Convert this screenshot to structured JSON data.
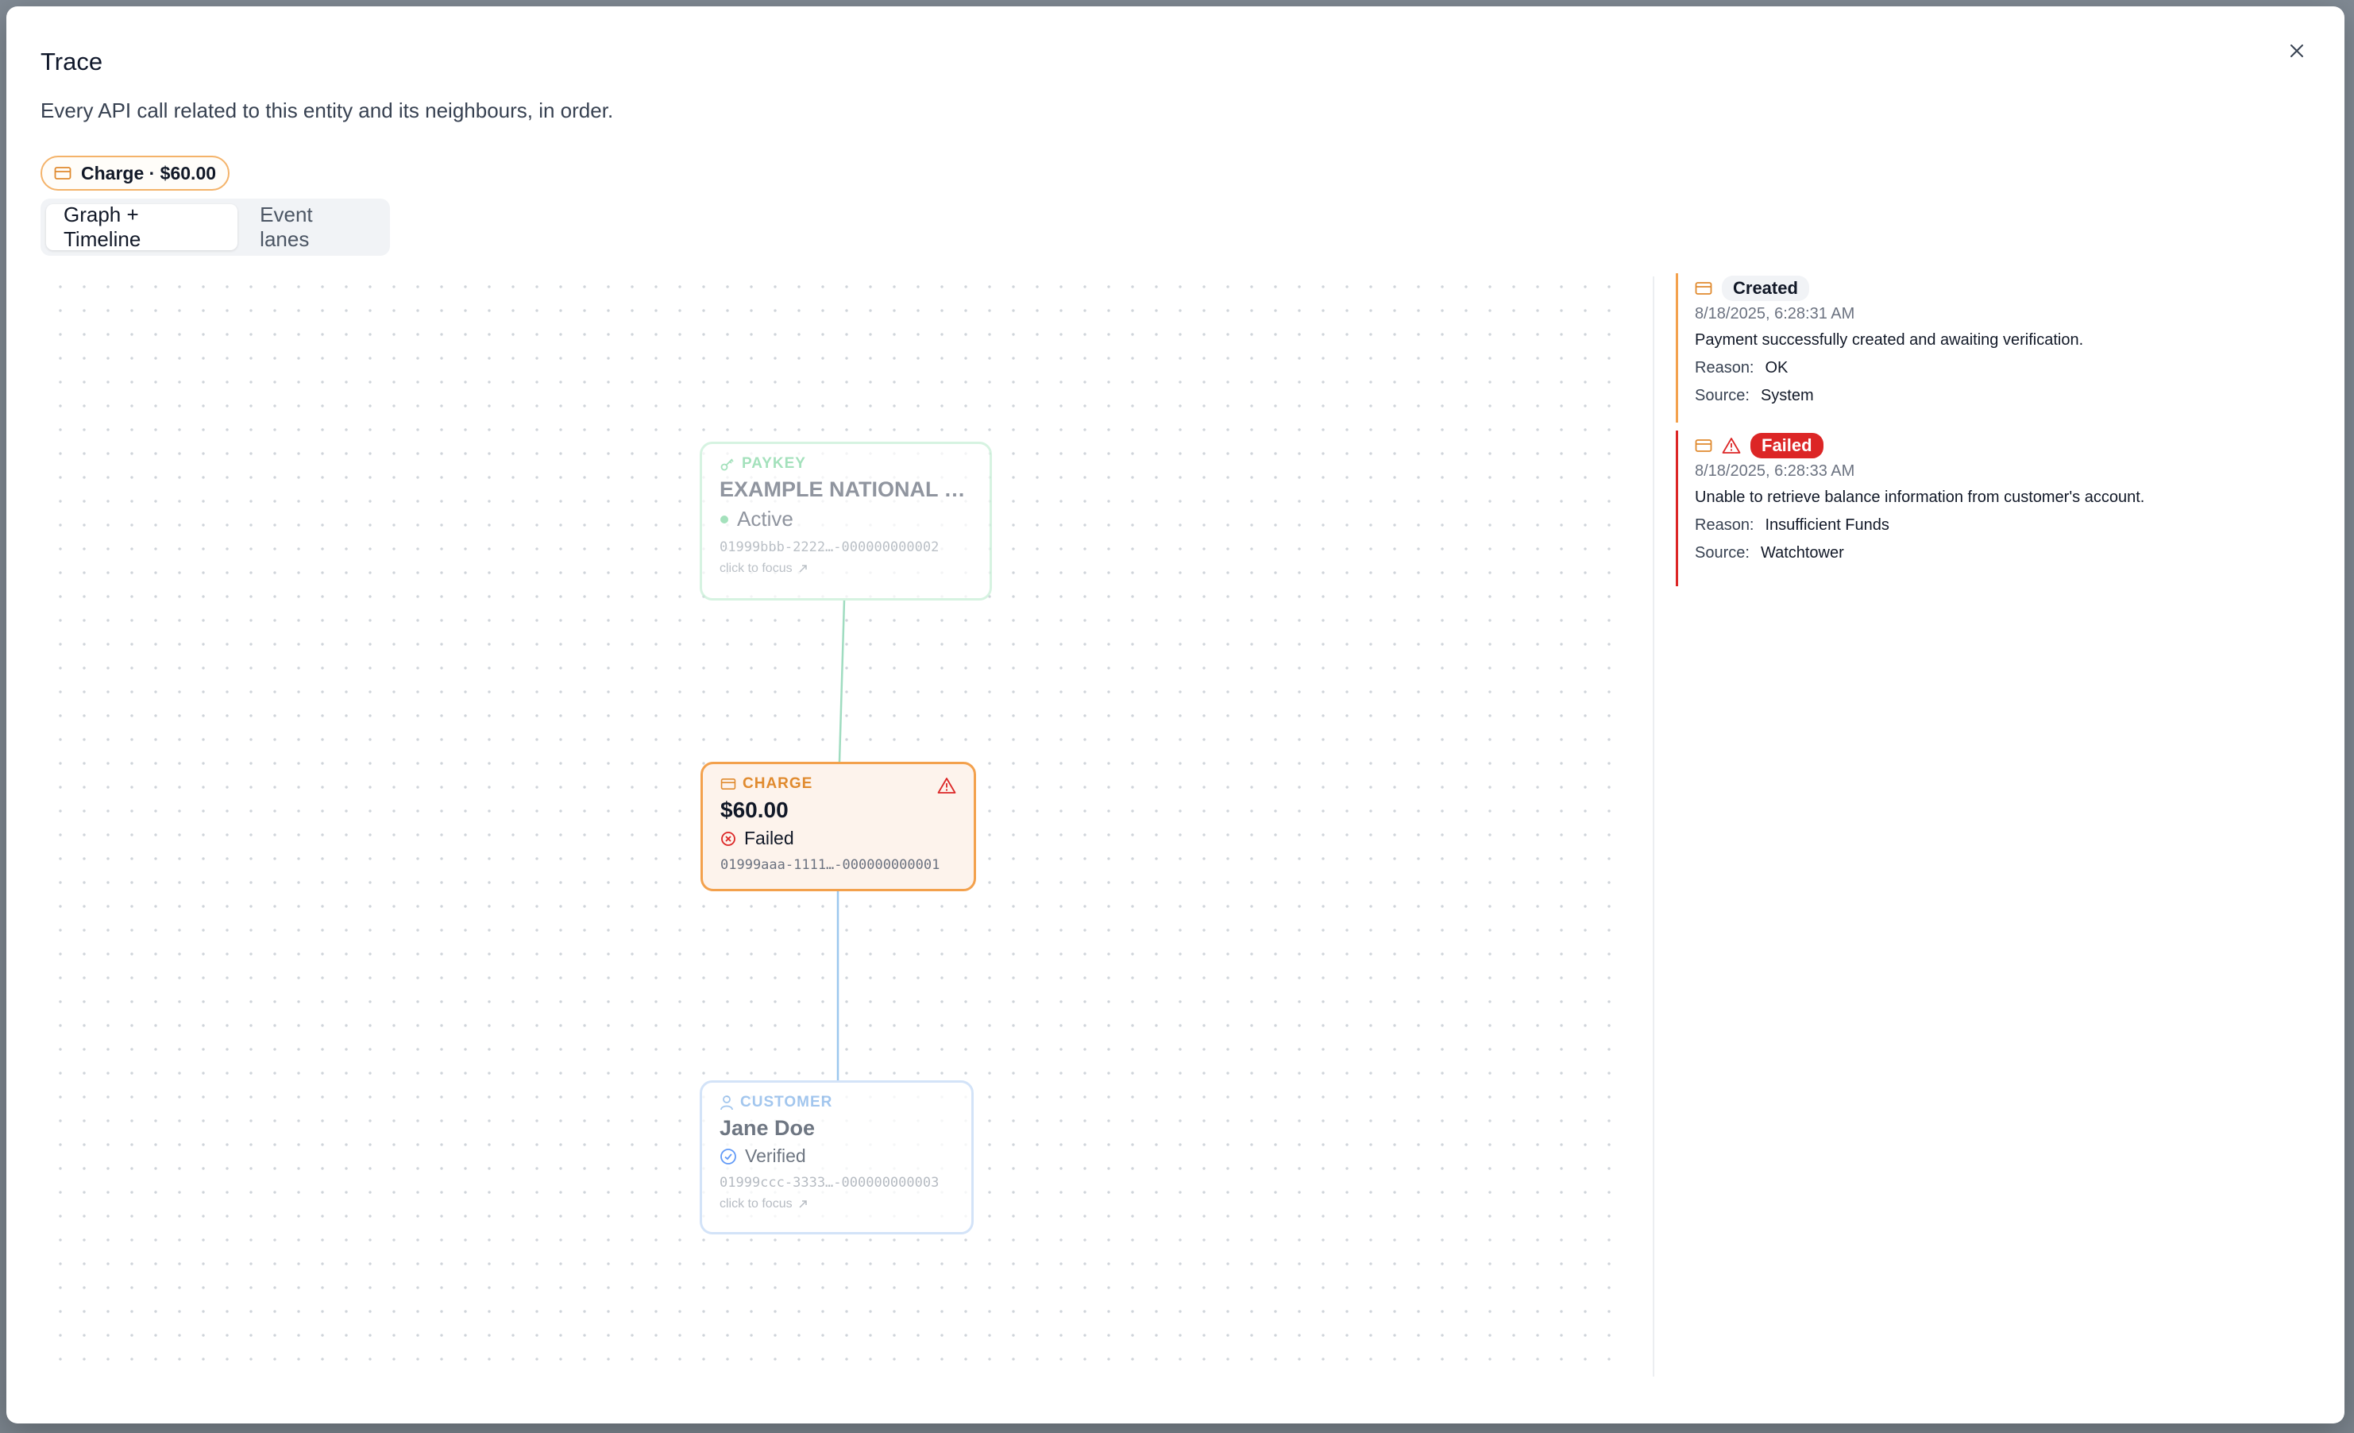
{
  "dialog": {
    "title": "Trace",
    "subtitle": "Every API call related to this entity and its neighbours, in order.",
    "entity_chip": "Charge · $60.00",
    "tabs": [
      {
        "label": "Graph + Timeline",
        "active": true
      },
      {
        "label": "Event lanes",
        "active": false
      }
    ]
  },
  "graph": {
    "nodes": {
      "paykey": {
        "kind": "PAYKEY",
        "name": "EXAMPLE NATIONAL B...",
        "status": "Active",
        "id": "01999bbb-2222…-000000000002",
        "hint": "click to focus"
      },
      "charge": {
        "kind": "CHARGE",
        "name": "$60.00",
        "status": "Failed",
        "id": "01999aaa-1111…-000000000001"
      },
      "customer": {
        "kind": "CUSTOMER",
        "name": "Jane Doe",
        "status": "Verified",
        "id": "01999ccc-3333…-000000000003",
        "hint": "click to focus"
      }
    }
  },
  "timeline": {
    "events": [
      {
        "badge": "Created",
        "timestamp": "8/18/2025, 6:28:31 AM",
        "message": "Payment successfully created and awaiting verification.",
        "reason_label": "Reason:",
        "reason": "OK",
        "source_label": "Source:",
        "source": "System"
      },
      {
        "badge": "Failed",
        "timestamp": "8/18/2025, 6:28:33 AM",
        "message": "Unable to retrieve balance information from customer's account.",
        "reason_label": "Reason:",
        "reason": "Insufficient Funds",
        "source_label": "Source:",
        "source": "Watchtower"
      }
    ]
  },
  "colors": {
    "charge_accent": "#f3a14d",
    "paykey_accent": "#86d8a6",
    "customer_accent": "#8bb8ea",
    "failed": "#dc2626"
  }
}
